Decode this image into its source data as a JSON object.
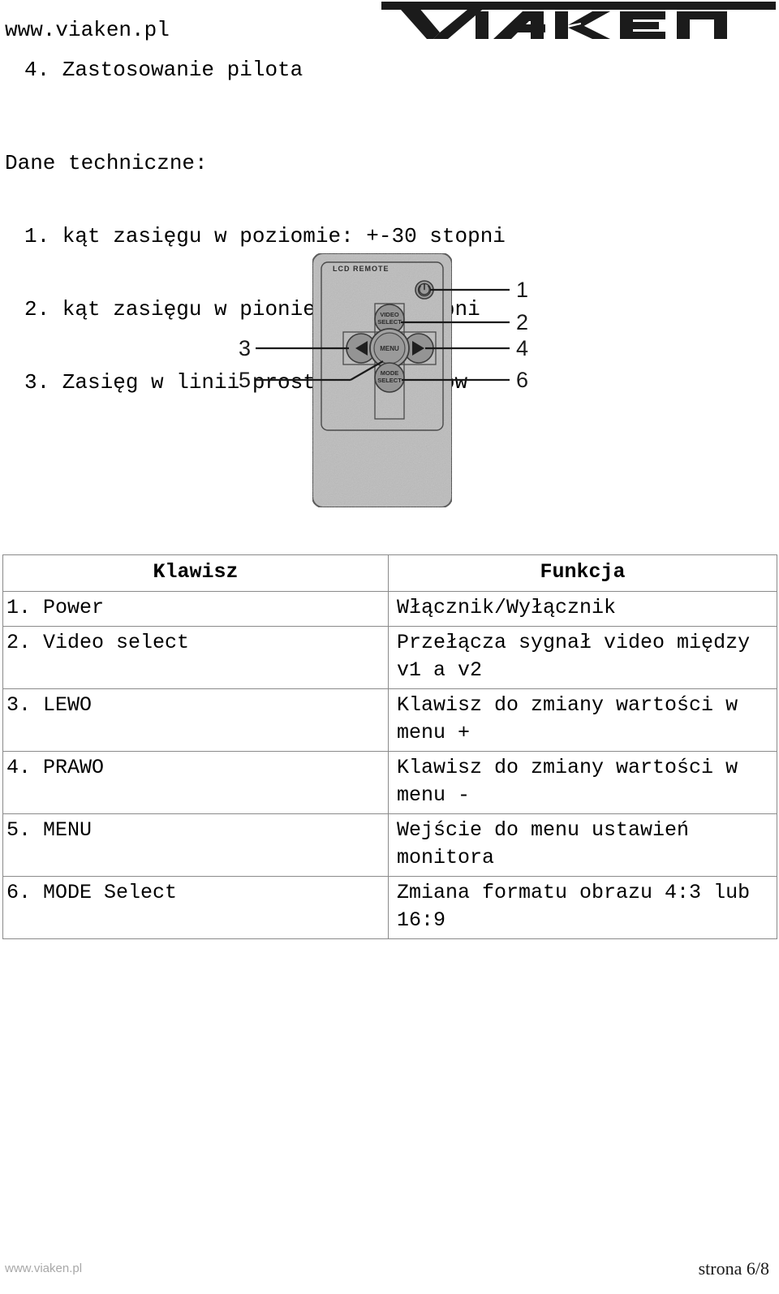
{
  "header": {
    "site_url": "www.viaken.pl",
    "logo_text": "VIAKEN",
    "section_title": "4. Zastosowanie pilota"
  },
  "specs": {
    "heading": "Dane techniczne:",
    "items": [
      "1. kąt zasięgu w poziomie: +-30 stopni",
      "2. kąt zasięgu w pionie: +-30 stopni",
      "3. Zasięg w linii prostej: 5 metrów"
    ]
  },
  "diagram": {
    "device_label": "LCD  REMOTE",
    "buttons": {
      "power": "⏻",
      "video_select_line1": "VIDEO",
      "video_select_line2": "SELECT",
      "menu": "MENU",
      "mode_select_line1": "MODE",
      "mode_select_line2": "SELECT",
      "left_arrow": "◀",
      "right_arrow": "▶"
    },
    "callouts": {
      "one": "1",
      "two": "2",
      "three": "3",
      "four": "4",
      "five": "5",
      "six": "6"
    },
    "colors": {
      "body_fill": "#b9b9b9",
      "button_fill": "#8f8f8f",
      "outline": "#3a3a3a"
    }
  },
  "table": {
    "headers": [
      "Klawisz",
      "Funkcja"
    ],
    "rows": [
      {
        "key": "1. Power",
        "func": "Włącznik/Wyłącznik"
      },
      {
        "key": "2. Video select",
        "func": "Przełącza sygnał video między\nv1 a v2"
      },
      {
        "key": "3. LEWO",
        "func": "Klawisz do zmiany wartości w\nmenu +"
      },
      {
        "key": "4. PRAWO",
        "func": "Klawisz do zmiany wartości w\nmenu -"
      },
      {
        "key": "5. MENU",
        "func": "Wejście do menu ustawień\nmonitora"
      },
      {
        "key": "6. MODE Select",
        "func": "Zmiana formatu obrazu 4:3 lub\n16:9"
      }
    ]
  },
  "footer": {
    "left": "www.viaken.pl",
    "right": "strona 6/8"
  }
}
